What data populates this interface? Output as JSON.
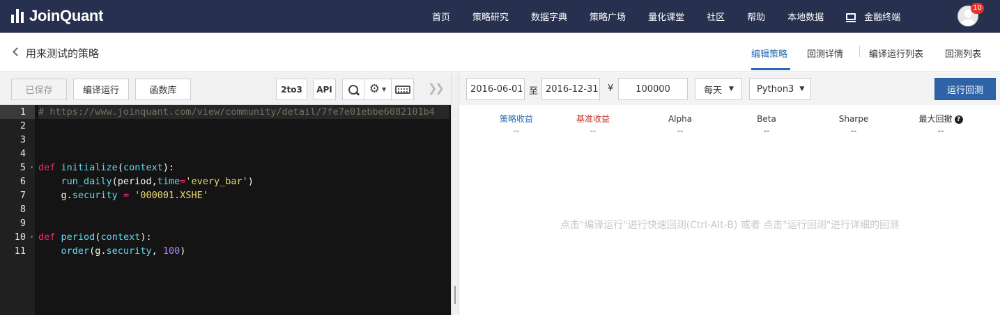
{
  "brand": {
    "name": "JoinQuant"
  },
  "nav": {
    "items": [
      "首页",
      "策略研究",
      "数据字典",
      "策略广场",
      "量化课堂",
      "社区",
      "帮助",
      "本地数据"
    ],
    "terminal_label": "金融终端",
    "notification_count": "10"
  },
  "titlebar": {
    "title": "用来测试的策略",
    "tabs": [
      "编辑策略",
      "回测详情",
      "编译运行列表",
      "回测列表"
    ],
    "active_tab": "编辑策略"
  },
  "editor_toolbar": {
    "saved_label": "已保存",
    "compile_run_label": "编译运行",
    "library_label": "函数库",
    "convert_label": "2to3",
    "api_label": "API",
    "search_icon": "search-icon",
    "settings_icon": "gear-icon",
    "keyboard_icon": "keyboard-icon",
    "collapse_icon": "double-chevron-right-icon"
  },
  "code": {
    "line_numbers": [
      "1",
      "2",
      "3",
      "4",
      "5",
      "6",
      "7",
      "8",
      "9",
      "10",
      "11"
    ],
    "fold_lines": [
      "5",
      "10"
    ],
    "active_line": "1",
    "lines": [
      [
        {
          "t": "cm",
          "v": "# https://www.joinquant.com/view/community/detail/7fe7e01ebbe6082101b4"
        }
      ],
      [],
      [],
      [],
      [
        {
          "t": "kw",
          "v": "def"
        },
        {
          "t": "",
          "v": " "
        },
        {
          "t": "fn",
          "v": "initialize"
        },
        {
          "t": "",
          "v": "("
        },
        {
          "t": "fn",
          "v": "context"
        },
        {
          "t": "",
          "v": "):"
        }
      ],
      [
        {
          "t": "",
          "v": "    "
        },
        {
          "t": "fn",
          "v": "run_daily"
        },
        {
          "t": "",
          "v": "(period,"
        },
        {
          "t": "fn",
          "v": "time"
        },
        {
          "t": "kw",
          "v": "="
        },
        {
          "t": "st",
          "v": "'every_bar'"
        },
        {
          "t": "",
          "v": ")"
        }
      ],
      [
        {
          "t": "",
          "v": "    g."
        },
        {
          "t": "fn",
          "v": "security"
        },
        {
          "t": "",
          "v": " "
        },
        {
          "t": "kw",
          "v": "="
        },
        {
          "t": "",
          "v": " "
        },
        {
          "t": "st",
          "v": "'000001.XSHE'"
        }
      ],
      [],
      [],
      [
        {
          "t": "kw",
          "v": "def"
        },
        {
          "t": "",
          "v": " "
        },
        {
          "t": "fn",
          "v": "period"
        },
        {
          "t": "",
          "v": "("
        },
        {
          "t": "fn",
          "v": "context"
        },
        {
          "t": "",
          "v": "):"
        }
      ],
      [
        {
          "t": "",
          "v": "    "
        },
        {
          "t": "fn",
          "v": "order"
        },
        {
          "t": "",
          "v": "(g."
        },
        {
          "t": "fn",
          "v": "security"
        },
        {
          "t": "",
          "v": ", "
        },
        {
          "t": "nb",
          "v": "100"
        },
        {
          "t": "",
          "v": ")"
        }
      ]
    ]
  },
  "backtest": {
    "start_date": "2016-06-01",
    "to_label": "至",
    "end_date": "2016-12-31",
    "currency_symbol": "¥",
    "capital": "100000",
    "frequency": "每天",
    "python_version": "Python3",
    "run_label": "运行回测"
  },
  "metrics": [
    {
      "label": "策略收益",
      "value": "--",
      "color": "#2b6cb0"
    },
    {
      "label": "基准收益",
      "value": "--",
      "color": "#c0392b"
    },
    {
      "label": "Alpha",
      "value": "--",
      "color": "#333333"
    },
    {
      "label": "Beta",
      "value": "--",
      "color": "#333333"
    },
    {
      "label": "Sharpe",
      "value": "--",
      "color": "#333333"
    },
    {
      "label": "最大回撤",
      "value": "--",
      "color": "#333333"
    }
  ],
  "hint": "点击\"编译运行\"进行快速回测(Ctrl-Alt-B) 或者 点击\"运行回测\"进行详细的回测"
}
